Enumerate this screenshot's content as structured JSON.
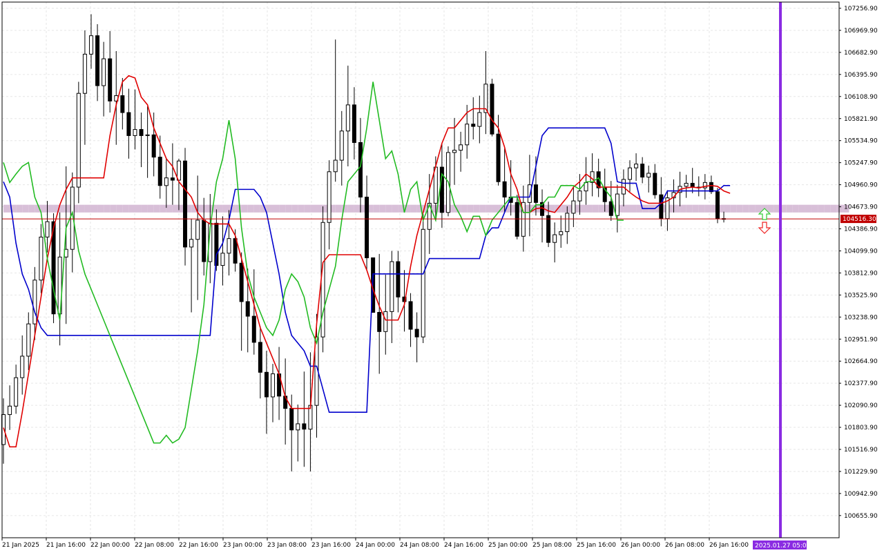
{
  "chart_data": {
    "type": "candlestick",
    "grid": true,
    "y_axis": {
      "position": "right",
      "ticks": [
        "107256.90",
        "106969.90",
        "106682.90",
        "106395.90",
        "106108.90",
        "105821.90",
        "105534.90",
        "105247.90",
        "104960.90",
        "104673.90",
        "104386.90",
        "104099.90",
        "103812.90",
        "103525.90",
        "103238.90",
        "102951.90",
        "102664.90",
        "102377.90",
        "102090.90",
        "101803.90",
        "101516.90",
        "101229.90",
        "100942.90",
        "100655.90"
      ],
      "range": [
        100400,
        107350
      ]
    },
    "x_axis": {
      "ticks": [
        "21 Jan 2025",
        "21 Jan 16:00",
        "22 Jan 00:00",
        "22 Jan 08:00",
        "22 Jan 16:00",
        "23 Jan 00:00",
        "23 Jan 08:00",
        "23 Jan 16:00",
        "24 Jan 00:00",
        "24 Jan 08:00",
        "24 Jan 16:00",
        "25 Jan 00:00",
        "25 Jan 08:00",
        "25 Jan 16:00",
        "26 Jan 00:00",
        "26 Jan 08:00",
        "26 Jan 16:00"
      ],
      "cursor_label": "2025.01.27 05:00"
    },
    "current_price": {
      "label": "104516.30",
      "value": 104516.3
    },
    "colors": {
      "bull": "#ffffff",
      "bear": "#000000",
      "wick": "#000000",
      "tenkan": "#e00000",
      "kijun": "#0000cc",
      "chikou": "#22bb22",
      "cloud_up": "#f4a460",
      "cloud_down": "#d8bfd8",
      "price_line": "#c00000",
      "cursor_line": "#8a2be2",
      "grid": "#e6e6e6",
      "arrow_up": "#33cc33",
      "arrow_down": "#ee2222"
    },
    "candles": [
      [
        101580,
        102180,
        101330,
        101970
      ],
      [
        101970,
        102350,
        101770,
        102080
      ],
      [
        102080,
        102620,
        101980,
        102450
      ],
      [
        102450,
        103000,
        102230,
        102730
      ],
      [
        102730,
        103300,
        102550,
        103150
      ],
      [
        103150,
        103890,
        102940,
        103720
      ],
      [
        103720,
        104450,
        103550,
        104280
      ],
      [
        104280,
        104750,
        104080,
        104480
      ],
      [
        104480,
        104590,
        103160,
        103280
      ],
      [
        103280,
        104600,
        102870,
        104020
      ],
      [
        104020,
        105200,
        103150,
        104120
      ],
      [
        104120,
        105120,
        103820,
        104930
      ],
      [
        104930,
        106300,
        104720,
        106150
      ],
      [
        106150,
        106970,
        105480,
        106660
      ],
      [
        106660,
        107180,
        106470,
        106900
      ],
      [
        106900,
        107050,
        106050,
        106250
      ],
      [
        106250,
        106820,
        105850,
        106600
      ],
      [
        106600,
        106960,
        105900,
        106050
      ],
      [
        106050,
        106700,
        105480,
        106120
      ],
      [
        106120,
        106350,
        105680,
        105900
      ],
      [
        105900,
        106210,
        105300,
        105600
      ],
      [
        105600,
        106200,
        105420,
        105680
      ],
      [
        105680,
        105900,
        105190,
        105600
      ],
      [
        105600,
        105980,
        105050,
        105610
      ],
      [
        105610,
        105900,
        105070,
        105320
      ],
      [
        105320,
        105600,
        104780,
        104950
      ],
      [
        104950,
        105310,
        104660,
        105050
      ],
      [
        105050,
        105500,
        104700,
        105020
      ],
      [
        105020,
        105300,
        104630,
        105270
      ],
      [
        105270,
        105440,
        103910,
        104150
      ],
      [
        104150,
        104520,
        103300,
        104250
      ],
      [
        104250,
        105080,
        103460,
        104500
      ],
      [
        104500,
        104790,
        103780,
        103960
      ],
      [
        103960,
        104840,
        103680,
        104460
      ],
      [
        104460,
        104640,
        103840,
        103910
      ],
      [
        103910,
        104550,
        103650,
        104070
      ],
      [
        104070,
        104630,
        103780,
        104260
      ],
      [
        104260,
        104380,
        103830,
        103940
      ],
      [
        103940,
        104080,
        102800,
        103440
      ],
      [
        103440,
        103870,
        102780,
        103250
      ],
      [
        103250,
        103860,
        102750,
        102910
      ],
      [
        102910,
        103120,
        102180,
        102520
      ],
      [
        102520,
        102800,
        101720,
        102200
      ],
      [
        102200,
        102630,
        101870,
        102500
      ],
      [
        102500,
        102850,
        101900,
        102210
      ],
      [
        102210,
        102700,
        101580,
        102050
      ],
      [
        102050,
        102230,
        101230,
        101770
      ],
      [
        101770,
        102100,
        101360,
        101850
      ],
      [
        101850,
        102530,
        101290,
        101780
      ],
      [
        101780,
        102780,
        101230,
        102090
      ],
      [
        102090,
        103280,
        101670,
        102980
      ],
      [
        102980,
        104680,
        102780,
        104470
      ],
      [
        104470,
        105280,
        104120,
        105130
      ],
      [
        105130,
        106850,
        105000,
        105280
      ],
      [
        105280,
        105920,
        104950,
        105660
      ],
      [
        105660,
        106510,
        105200,
        106000
      ],
      [
        106000,
        106230,
        105290,
        105510
      ],
      [
        105510,
        105830,
        104600,
        104800
      ],
      [
        104800,
        105080,
        103840,
        104010
      ],
      [
        104010,
        103950,
        103400,
        103300
      ],
      [
        103300,
        104060,
        102500,
        103050
      ],
      [
        103050,
        103790,
        102750,
        103310
      ],
      [
        103310,
        104100,
        102900,
        103960
      ],
      [
        103960,
        104100,
        103300,
        103500
      ],
      [
        103500,
        103850,
        103050,
        103440
      ],
      [
        103440,
        103550,
        102850,
        103080
      ],
      [
        103080,
        103300,
        102650,
        102980
      ],
      [
        102980,
        104580,
        102900,
        104380
      ],
      [
        104380,
        105100,
        104060,
        104720
      ],
      [
        104720,
        105330,
        104490,
        105190
      ],
      [
        105190,
        105500,
        104400,
        104600
      ],
      [
        104600,
        105460,
        104550,
        105380
      ],
      [
        105380,
        105830,
        104960,
        105410
      ],
      [
        105410,
        105650,
        105130,
        105480
      ],
      [
        105480,
        106000,
        105300,
        105750
      ],
      [
        105750,
        106100,
        105550,
        105720
      ],
      [
        105720,
        106120,
        105500,
        105900
      ],
      [
        105900,
        106700,
        105620,
        106270
      ],
      [
        106270,
        106340,
        105590,
        105620
      ],
      [
        105620,
        105870,
        104950,
        105000
      ],
      [
        105000,
        105430,
        104600,
        104800
      ],
      [
        104800,
        105280,
        104560,
        104730
      ],
      [
        104730,
        104830,
        104250,
        104290
      ],
      [
        104290,
        104950,
        104090,
        104730
      ],
      [
        104730,
        105350,
        104290,
        104960
      ],
      [
        104960,
        105330,
        104560,
        104730
      ],
      [
        104730,
        104900,
        104210,
        104560
      ],
      [
        104560,
        104740,
        104150,
        104210
      ],
      [
        104210,
        104470,
        103950,
        104310
      ],
      [
        104310,
        104560,
        104140,
        104350
      ],
      [
        104350,
        104680,
        104190,
        104590
      ],
      [
        104590,
        104940,
        104410,
        104750
      ],
      [
        104750,
        105100,
        104570,
        104880
      ],
      [
        104880,
        105320,
        104700,
        104990
      ],
      [
        104990,
        105370,
        104810,
        105130
      ],
      [
        105130,
        105300,
        104800,
        104920
      ],
      [
        104920,
        105170,
        104610,
        104740
      ],
      [
        104740,
        105010,
        104490,
        104560
      ],
      [
        104560,
        104960,
        104340,
        104840
      ],
      [
        104840,
        105160,
        104680,
        105030
      ],
      [
        105030,
        105280,
        104870,
        105180
      ],
      [
        105180,
        105370,
        105010,
        105230
      ],
      [
        105230,
        105320,
        104980,
        105060
      ],
      [
        105060,
        105210,
        104860,
        105110
      ],
      [
        105110,
        105230,
        104780,
        104830
      ],
      [
        104830,
        105060,
        104420,
        104520
      ],
      [
        104520,
        104890,
        104360,
        104790
      ],
      [
        104790,
        105030,
        104600,
        104860
      ],
      [
        104860,
        105130,
        104680,
        104940
      ],
      [
        104940,
        105090,
        104790,
        104980
      ],
      [
        104980,
        105180,
        104850,
        104930
      ],
      [
        104930,
        105070,
        104810,
        104920
      ],
      [
        104920,
        105100,
        104770,
        104990
      ],
      [
        104990,
        105080,
        104840,
        104870
      ],
      [
        104870,
        104920,
        104460,
        104520
      ],
      [
        104520,
        104610,
        104470,
        104516
      ]
    ],
    "tenkan": [
      101800,
      101550,
      101550,
      102000,
      102500,
      103000,
      103500,
      104000,
      104400,
      104700,
      104900,
      105050,
      105050,
      105050,
      105050,
      105050,
      105050,
      105600,
      106000,
      106300,
      106380,
      106350,
      106100,
      106000,
      105700,
      105500,
      105300,
      105200,
      105000,
      104900,
      104800,
      104600,
      104500,
      104450,
      104450,
      104450,
      104450,
      104300,
      104000,
      103700,
      103400,
      103100,
      102900,
      102700,
      102500,
      102200,
      102050,
      102050,
      102050,
      102050,
      103150,
      103950,
      104050,
      104050,
      104050,
      104050,
      104050,
      104050,
      103850,
      103600,
      103380,
      103200,
      103200,
      103200,
      103400,
      103900,
      104300,
      104600,
      104900,
      105200,
      105500,
      105700,
      105700,
      105800,
      105900,
      105950,
      105950,
      105950,
      105800,
      105700,
      105450,
      105100,
      104900,
      104600,
      104600,
      104650,
      104660,
      104620,
      104600,
      104700,
      104800,
      104930,
      105000,
      105100,
      105040,
      104930,
      104930,
      104930,
      104930,
      104930,
      104860,
      104800,
      104750,
      104720,
      104720,
      104720,
      104750,
      104800,
      104900,
      104920,
      104930,
      104920,
      104940,
      104950,
      104940,
      104880,
      104850
    ],
    "kijun": [
      105000,
      104800,
      104200,
      103800,
      103600,
      103300,
      103100,
      103000,
      103000,
      103000,
      103000,
      103000,
      103000,
      103000,
      103000,
      103000,
      103000,
      103000,
      103000,
      103000,
      103000,
      103000,
      103000,
      103000,
      103000,
      103000,
      103000,
      103000,
      103000,
      103000,
      103000,
      103000,
      103000,
      103000,
      104050,
      104200,
      104500,
      104900,
      104900,
      104900,
      104900,
      104800,
      104600,
      104200,
      103800,
      103300,
      103000,
      102900,
      102800,
      102600,
      102600,
      102300,
      102000,
      102000,
      102000,
      102000,
      102000,
      102000,
      102000,
      103800,
      103800,
      103800,
      103800,
      103800,
      103800,
      103800,
      103800,
      103800,
      104000,
      104000,
      104000,
      104000,
      104000,
      104000,
      104000,
      104000,
      104000,
      104300,
      104400,
      104400,
      104600,
      104800,
      104800,
      104800,
      104800,
      105200,
      105600,
      105700,
      105700,
      105700,
      105700,
      105700,
      105700,
      105700,
      105700,
      105700,
      105700,
      105500,
      105000,
      104980,
      104980,
      104980,
      104650,
      104650,
      104650,
      104720,
      104880,
      104880,
      104880,
      104880,
      104880,
      104880,
      104880,
      104880,
      104880,
      104950,
      104950
    ],
    "chikou": [
      105250,
      104990,
      105100,
      105200,
      105250,
      104800,
      104600,
      104000,
      103600,
      103200,
      104400,
      104600,
      104100,
      103800,
      103600,
      103400,
      103200,
      103000,
      102800,
      102600,
      102400,
      102200,
      102000,
      101800,
      101600,
      101600,
      101700,
      101600,
      101650,
      101800,
      102300,
      102800,
      103400,
      104400,
      105000,
      105300,
      105800,
      105300,
      104400,
      103800,
      103500,
      103300,
      103100,
      103000,
      103200,
      103600,
      103800,
      103700,
      103500,
      103100,
      102900,
      103300,
      103600,
      103900,
      104500,
      105000,
      105100,
      105200,
      105700,
      106300,
      105800,
      105300,
      105400,
      105100,
      104600,
      104900,
      105000,
      104500,
      104700,
      104500,
      105100,
      105000,
      104700,
      104550,
      104350,
      104550,
      104550,
      104300,
      104500,
      104600,
      104700,
      104800,
      104800,
      104600,
      104600,
      104700,
      104700,
      104800,
      104800,
      104950,
      104950,
      104950,
      104900,
      105000,
      105000,
      105050,
      104900,
      104800,
      104500,
      104500
    ],
    "senkou_a": [
      104600,
      104600,
      104600,
      104600,
      104600,
      104600,
      104600,
      104600,
      104600,
      104600,
      104600,
      104600,
      104600,
      104600,
      104600,
      104600,
      104600,
      104600,
      104600,
      104600,
      104600,
      104600,
      104600,
      104600,
      104600,
      104600,
      104600,
      104600,
      104600,
      104600,
      104600,
      104600,
      104600,
      104600,
      104600,
      104600,
      104600,
      104600,
      104600,
      104600,
      104600,
      104600,
      104600,
      104600,
      104600,
      104600,
      104600,
      104600,
      104600,
      104600,
      104600,
      104600,
      104600,
      104600,
      104600,
      104600,
      104600,
      104600,
      104600,
      104600,
      104600,
      104600,
      104600,
      104600,
      104600,
      104600,
      104600,
      104600,
      104600,
      104600,
      104600,
      104600,
      104600,
      104600,
      104600,
      104600,
      104600,
      104600,
      104600,
      104600,
      104600,
      104600,
      104600,
      104600,
      104600,
      104600,
      104600,
      104600,
      104600,
      104600,
      104600,
      104600,
      104600,
      104600,
      104600,
      104600,
      104600,
      104600,
      104600,
      104600,
      104600,
      104600,
      104600,
      104600,
      104600,
      104600,
      104600,
      104600,
      104600,
      104600,
      104600,
      104600,
      104600,
      104600,
      104600,
      104600,
      104600,
      104600,
      104600,
      104600,
      104600,
      104600,
      104600,
      104600,
      104600,
      104600,
      104600,
      104600,
      104600,
      104600,
      104600,
      104600,
      104600,
      104600,
      104600,
      104600
    ],
    "senkou_b": [
      104700,
      104700,
      104700,
      104700,
      104700,
      104700,
      104700,
      104700,
      104700,
      104700,
      104700,
      104700,
      104700,
      104700,
      104700,
      104700,
      104700,
      104700,
      104700,
      104700,
      104700,
      104700,
      104700,
      104700,
      104700,
      104700,
      104700,
      104700,
      104700,
      104700,
      104700,
      104700,
      104700,
      104700,
      104700,
      104700,
      104700,
      104700,
      104700,
      104700,
      104700,
      104700,
      104700,
      104700,
      104700,
      104700,
      104700,
      104700,
      104700,
      104700,
      104700,
      104700,
      104700,
      104700,
      104700,
      104700,
      104700,
      104700,
      104700,
      104700,
      104700,
      104700,
      104700,
      104700,
      104700,
      104700,
      104700,
      104700,
      104700,
      104700,
      104700,
      104700,
      104700,
      104700,
      104700,
      104700,
      104700,
      104700,
      104700,
      104700,
      104700,
      104700,
      104700,
      104700,
      104700,
      104700,
      104700,
      104700,
      104700,
      104700,
      104700,
      104700,
      104700,
      104700,
      104700,
      104700,
      104700,
      104700,
      104700,
      104700,
      104700,
      104700,
      104700,
      104700,
      104700,
      104700,
      104700,
      104700,
      104700,
      104700,
      104700,
      104700,
      104700,
      104700,
      104700,
      104700,
      104700,
      104700,
      104700,
      104700,
      104700,
      104700,
      104700,
      104700,
      104700,
      104700,
      104700,
      104700,
      104700,
      104700,
      104700,
      104700,
      104700,
      104700,
      104700,
      104700
    ]
  }
}
